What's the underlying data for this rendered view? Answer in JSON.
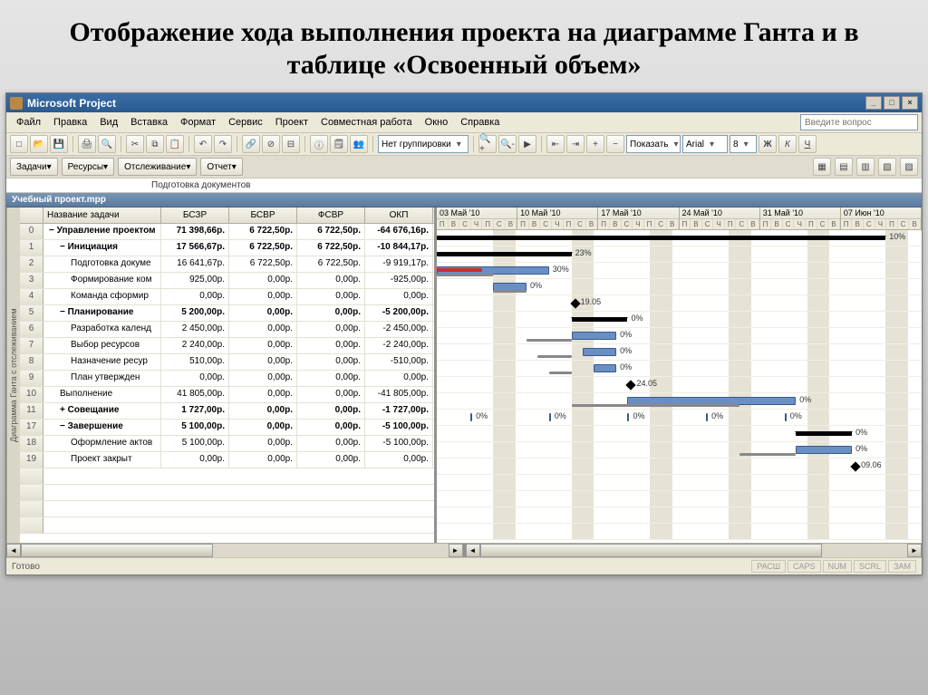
{
  "slide_title": "Отображение хода выполнения проекта на диаграмме Ганта и в таблице «Освоенный объем»",
  "app": {
    "title": "Microsoft Project",
    "help_placeholder": "Введите вопрос",
    "menu": [
      "Файл",
      "Правка",
      "Вид",
      "Вставка",
      "Формат",
      "Сервис",
      "Проект",
      "Совместная работа",
      "Окно",
      "Справка"
    ],
    "grouping": "Нет группировки",
    "show_label": "Показать",
    "font_name": "Arial",
    "font_size": "8",
    "nav": {
      "tasks": "Задачи",
      "resources": "Ресурсы",
      "tracking": "Отслеживание",
      "report": "Отчет"
    },
    "info_task": "Подготовка документов",
    "doc_title": "Учебный проект.mpp",
    "sidebar_label": "Диаграмма Ганта с отслеживанием"
  },
  "columns": {
    "name": "Название задачи",
    "c1": "БСЗР",
    "c2": "БСВР",
    "c3": "ФСВР",
    "c4": "ОКП"
  },
  "weeks": [
    "03 Май '10",
    "10 Май '10",
    "17 Май '10",
    "24 Май '10",
    "31 Май '10",
    "07 Июн '10"
  ],
  "days": [
    "П",
    "В",
    "С",
    "Ч",
    "П",
    "С",
    "В"
  ],
  "rows": [
    {
      "id": "0",
      "lvl": 1,
      "sum": true,
      "exp": "−",
      "name": "Управление проектом",
      "c1": "71 398,66р.",
      "c2": "6 722,50р.",
      "c3": "6 722,50р.",
      "c4": "-64 676,16р."
    },
    {
      "id": "1",
      "lvl": 2,
      "sum": true,
      "exp": "−",
      "name": "Инициация",
      "c1": "17 566,67р.",
      "c2": "6 722,50р.",
      "c3": "6 722,50р.",
      "c4": "-10 844,17р."
    },
    {
      "id": "2",
      "lvl": 3,
      "name": "Подготовка докуме",
      "c1": "16 641,67р.",
      "c2": "6 722,50р.",
      "c3": "6 722,50р.",
      "c4": "-9 919,17р."
    },
    {
      "id": "3",
      "lvl": 3,
      "name": "Формирование ком",
      "c1": "925,00р.",
      "c2": "0,00р.",
      "c3": "0,00р.",
      "c4": "-925,00р."
    },
    {
      "id": "4",
      "lvl": 3,
      "name": "Команда сформир",
      "c1": "0,00р.",
      "c2": "0,00р.",
      "c3": "0,00р.",
      "c4": "0,00р."
    },
    {
      "id": "5",
      "lvl": 2,
      "sum": true,
      "exp": "−",
      "name": "Планирование",
      "c1": "5 200,00р.",
      "c2": "0,00р.",
      "c3": "0,00р.",
      "c4": "-5 200,00р."
    },
    {
      "id": "6",
      "lvl": 3,
      "name": "Разработка календ",
      "c1": "2 450,00р.",
      "c2": "0,00р.",
      "c3": "0,00р.",
      "c4": "-2 450,00р."
    },
    {
      "id": "7",
      "lvl": 3,
      "name": "Выбор ресурсов",
      "c1": "2 240,00р.",
      "c2": "0,00р.",
      "c3": "0,00р.",
      "c4": "-2 240,00р."
    },
    {
      "id": "8",
      "lvl": 3,
      "name": "Назначение ресур",
      "c1": "510,00р.",
      "c2": "0,00р.",
      "c3": "0,00р.",
      "c4": "-510,00р."
    },
    {
      "id": "9",
      "lvl": 3,
      "name": "План утвержден",
      "c1": "0,00р.",
      "c2": "0,00р.",
      "c3": "0,00р.",
      "c4": "0,00р."
    },
    {
      "id": "10",
      "lvl": 2,
      "name": "Выполнение",
      "c1": "41 805,00р.",
      "c2": "0,00р.",
      "c3": "0,00р.",
      "c4": "-41 805,00р."
    },
    {
      "id": "11",
      "lvl": 2,
      "sum": true,
      "exp": "+",
      "name": "Совещание",
      "c1": "1 727,00р.",
      "c2": "0,00р.",
      "c3": "0,00р.",
      "c4": "-1 727,00р."
    },
    {
      "id": "17",
      "lvl": 2,
      "sum": true,
      "exp": "−",
      "name": "Завершение",
      "c1": "5 100,00р.",
      "c2": "0,00р.",
      "c3": "0,00р.",
      "c4": "-5 100,00р."
    },
    {
      "id": "18",
      "lvl": 3,
      "name": "Оформление актов",
      "c1": "5 100,00р.",
      "c2": "0,00р.",
      "c3": "0,00р.",
      "c4": "-5 100,00р."
    },
    {
      "id": "19",
      "lvl": 3,
      "name": "Проект закрыт",
      "c1": "0,00р.",
      "c2": "0,00р.",
      "c3": "0,00р.",
      "c4": "0,00р."
    }
  ],
  "gantt_labels": {
    "p10": "10%",
    "p23": "23%",
    "p30": "30%",
    "p0": "0%",
    "d1905": "19.05",
    "d2405": "24.05",
    "d0906": "09.06"
  },
  "status": {
    "ready": "Готово",
    "boxes": [
      "РАСШ",
      "CAPS",
      "NUM",
      "SCRL",
      "ЗАМ"
    ]
  }
}
